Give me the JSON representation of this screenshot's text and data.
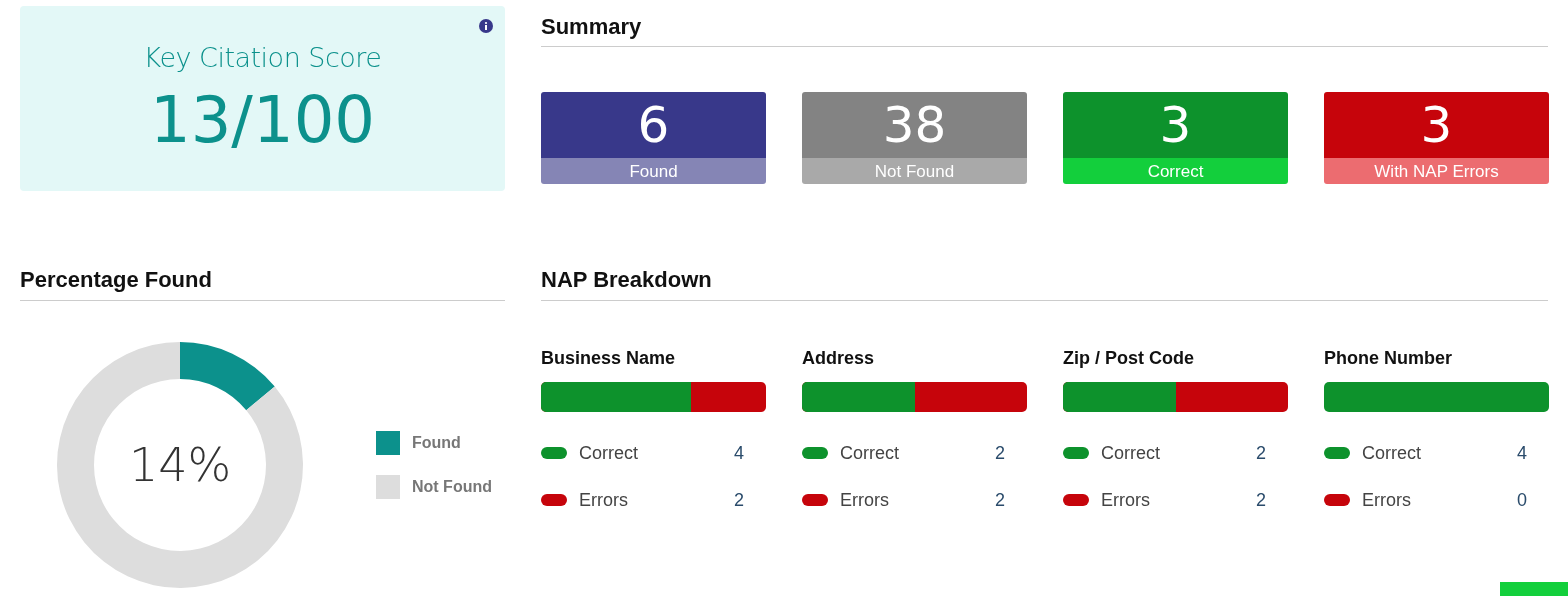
{
  "score_card": {
    "title": "Key Citation Score",
    "score": "13/100"
  },
  "summary": {
    "title": "Summary",
    "tiles": [
      {
        "value": "6",
        "label": "Found",
        "color": "#38388a",
        "footer": {
          "color": "#8585b5"
        }
      },
      {
        "value": "38",
        "label": "Not Found",
        "color": "#838383",
        "footer": {
          "color": "#a9a9a9"
        }
      },
      {
        "value": "3",
        "label": "Correct",
        "color": "#0d922c",
        "footer": {
          "color": "#13cf3c"
        }
      },
      {
        "value": "3",
        "label": "With NAP Errors",
        "color": "#c6040b",
        "footer": {
          "color": "#ec6c70"
        }
      }
    ]
  },
  "percentage_found": {
    "title": "Percentage Found",
    "center_label": "14%",
    "chart_data": {
      "type": "donut",
      "categories": [
        "Found",
        "Not Found"
      ],
      "values": [
        14,
        86
      ]
    },
    "slices": [
      {
        "color": "#0c918c"
      },
      {
        "color": "#dddddd"
      }
    ]
  },
  "nap_breakdown": {
    "title": "NAP Breakdown",
    "items": [
      {
        "title": "Business Name",
        "level": 0.667,
        "rows": [
          {
            "kind": "correct",
            "label": "Correct",
            "count": "4"
          },
          {
            "kind": "errors",
            "label": "Errors",
            "count": "2"
          }
        ]
      },
      {
        "title": "Address",
        "level": 0.5,
        "rows": [
          {
            "kind": "correct",
            "label": "Correct",
            "count": "2"
          },
          {
            "kind": "errors",
            "label": "Errors",
            "count": "2"
          }
        ]
      },
      {
        "title": "Zip / Post Code",
        "level": 0.5,
        "rows": [
          {
            "kind": "correct",
            "label": "Correct",
            "count": "2"
          },
          {
            "kind": "errors",
            "label": "Errors",
            "count": "2"
          }
        ]
      },
      {
        "title": "Phone Number",
        "level": 1.0,
        "rows": [
          {
            "kind": "correct",
            "label": "Correct",
            "count": "4"
          },
          {
            "kind": "errors",
            "label": "Errors",
            "count": "0"
          }
        ]
      }
    ]
  }
}
